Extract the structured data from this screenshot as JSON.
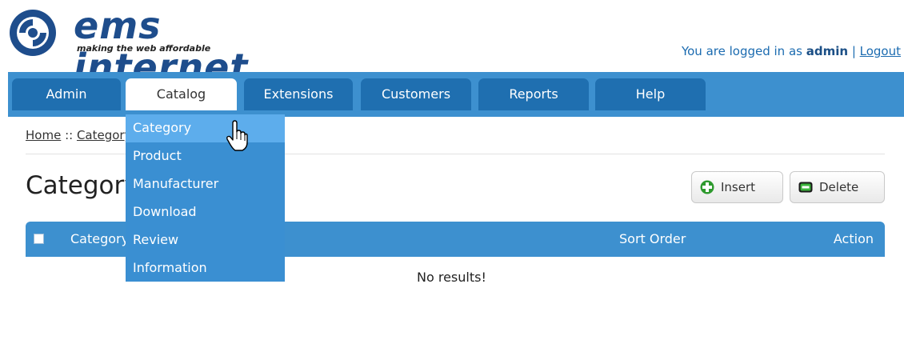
{
  "header": {
    "logo_title": "ems internet",
    "logo_tagline": "making the web affordable",
    "login_prefix": "You are logged in as ",
    "username": "admin",
    "separator": " | ",
    "logout_label": "Logout"
  },
  "menu": {
    "tabs": [
      "Admin",
      "Catalog",
      "Extensions",
      "Customers",
      "Reports",
      "Help"
    ],
    "active": "Catalog"
  },
  "dropdown": {
    "items": [
      "Category",
      "Product",
      "Manufacturer",
      "Download",
      "Review",
      "Information"
    ],
    "hovered": "Category"
  },
  "breadcrumb": {
    "home": "Home",
    "separator": " :: ",
    "current": "Category"
  },
  "page": {
    "title": "Category",
    "insert_label": "Insert",
    "delete_label": "Delete"
  },
  "table": {
    "columns": [
      "Category Name",
      "Sort Order",
      "Action"
    ],
    "empty_message": "No results!"
  },
  "colors": {
    "menu_bar": "#3d90cf",
    "tab": "#1f6fb0",
    "dropdown": "#3a8fd2",
    "dropdown_hover": "#5dadec",
    "brand": "#1e4d8c"
  }
}
